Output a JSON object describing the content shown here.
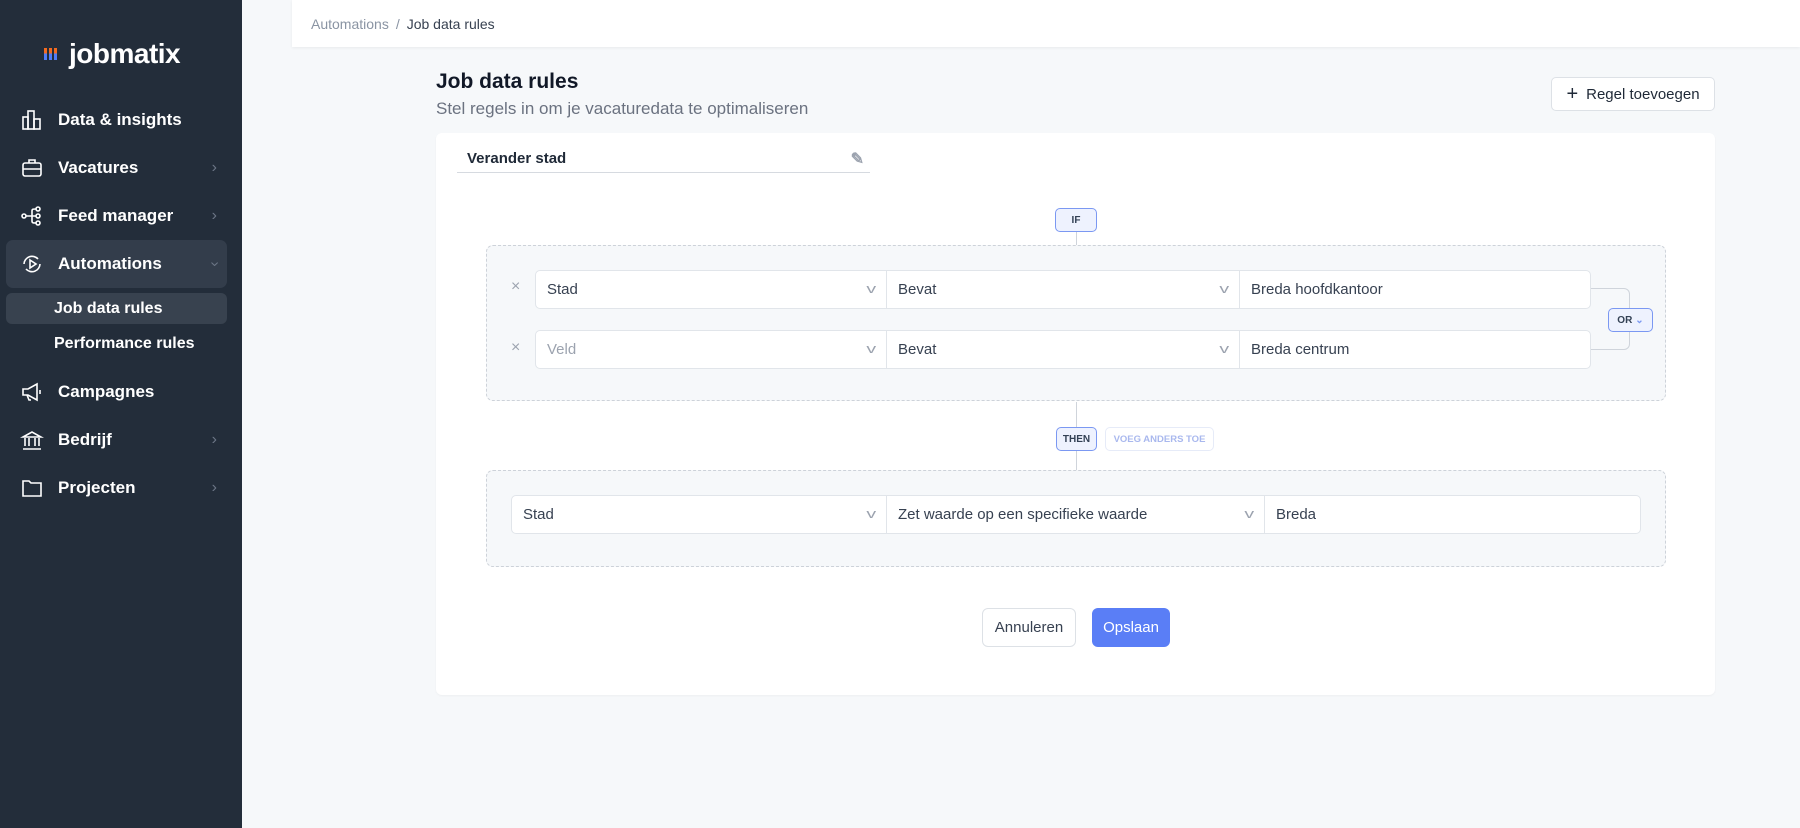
{
  "brand": {
    "name": "jobmatix"
  },
  "sidebar": {
    "items": [
      {
        "label": "Data & insights",
        "icon": "chart-bars-icon",
        "chevron": false
      },
      {
        "label": "Vacatures",
        "icon": "briefcase-icon",
        "chevron": true
      },
      {
        "label": "Feed manager",
        "icon": "share-nodes-icon",
        "chevron": true
      },
      {
        "label": "Automations",
        "icon": "automation-play-icon",
        "chevron": true,
        "expanded": true,
        "active": true
      },
      {
        "label": "Campagnes",
        "icon": "megaphone-icon",
        "chevron": false
      },
      {
        "label": "Bedrijf",
        "icon": "bank-icon",
        "chevron": true
      },
      {
        "label": "Projecten",
        "icon": "folder-icon",
        "chevron": true
      }
    ],
    "subitems": [
      {
        "label": "Job data rules",
        "active": true
      },
      {
        "label": "Performance rules"
      }
    ]
  },
  "breadcrumb": {
    "parent": "Automations",
    "separator": "/",
    "current": "Job data rules"
  },
  "page": {
    "title": "Job data rules",
    "subtitle": "Stel regels in om je vacaturedata te optimaliseren",
    "add_button": "Regel toevoegen"
  },
  "rule": {
    "name": "Verander stad",
    "if_label": "IF",
    "or_label": "OR",
    "then_label": "THEN",
    "else_label": "VOEG ANDERS TOE",
    "conditions": [
      {
        "field": "Stad",
        "field_placeholder": false,
        "operator": "Bevat",
        "value": "Breda hoofdkantoor"
      },
      {
        "field": "Veld",
        "field_placeholder": true,
        "operator": "Bevat",
        "value": "Breda centrum"
      }
    ],
    "action": {
      "field": "Stad",
      "operation": "Zet waarde op een specifieke waarde",
      "value": "Breda"
    }
  },
  "buttons": {
    "cancel": "Annuleren",
    "save": "Opslaan"
  },
  "colors": {
    "sidebar": "#232d3a",
    "primary": "#4f7cf7",
    "accent_orange": "#f36b21"
  }
}
